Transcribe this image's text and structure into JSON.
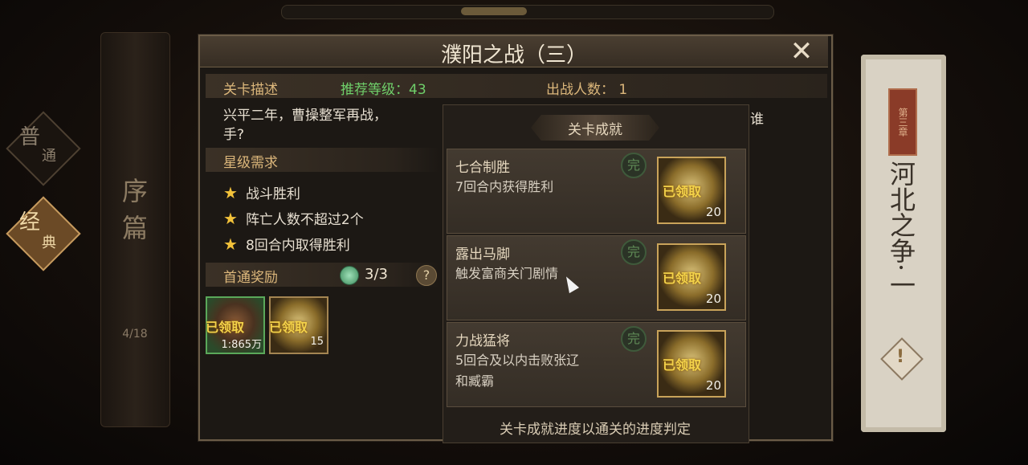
{
  "side_nav": {
    "mode_normal": "普",
    "mode_normal_sub": "通",
    "mode_classic": "经",
    "mode_classic_sub": "典",
    "scroll_title": "序篇",
    "page_count": "4/18"
  },
  "chapter": {
    "seal": "第三章",
    "title": "河北之争·一"
  },
  "dialog": {
    "title": "濮阳之战（三）",
    "close_icon": "close-icon",
    "info": {
      "desc_label": "关卡描述",
      "recommended_level": "推荐等级：43",
      "battle_count": "出战人数：  1"
    },
    "description": "兴平二年，曹操整军再战，",
    "description_tail": "谁",
    "description_line2": "手?",
    "star_header": "星级需求",
    "stars": [
      {
        "text": "战斗胜利"
      },
      {
        "text": "阵亡人数不超过2个"
      },
      {
        "text": "8回合内取得胜利"
      }
    ],
    "first_reward_label": "首通奖励",
    "first_reward_progress": "3/3",
    "help": "?",
    "rewards": [
      {
        "stamp": "已领取",
        "count": "1:865万"
      },
      {
        "stamp": "已领取",
        "count": "15"
      }
    ]
  },
  "achievements": {
    "header": "关卡成就",
    "items": [
      {
        "name": "七合制胜",
        "desc": "7回合内获得胜利",
        "done": "完",
        "stamp": "已领取",
        "count": "20"
      },
      {
        "name": "露出马脚",
        "desc": "触发富商关门剧情",
        "done": "完",
        "stamp": "已领取",
        "count": "20"
      },
      {
        "name": "力战猛将",
        "desc": "5回合及以内击败张辽",
        "desc2": "和臧霸",
        "done": "完",
        "stamp": "已领取",
        "count": "20"
      }
    ],
    "footer": "关卡成就进度以通关的进度判定"
  },
  "colors": {
    "gold_label": "#dcb77b",
    "green_level": "#6fcf6a",
    "star": "#f3c23a",
    "stamp": "#f3d24a"
  }
}
